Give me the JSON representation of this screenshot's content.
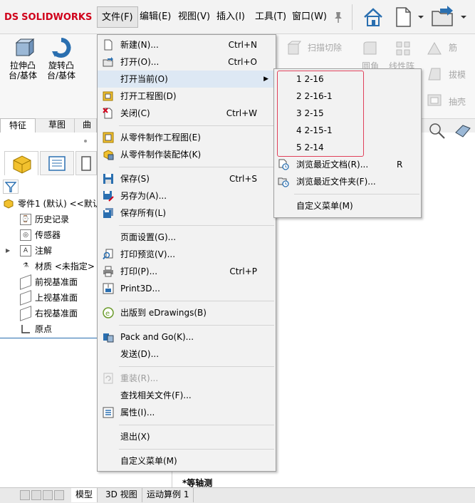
{
  "app": {
    "brand": "SOLIDWORKS",
    "brand_mark": "DS"
  },
  "menubar": [
    "文件(F)",
    "编辑(E)",
    "视图(V)",
    "插入(I)",
    "工具(T)",
    "窗口(W)"
  ],
  "commands": {
    "extrude_boss": "拉伸凸台/基体",
    "revolve_boss": "旋转凸台/基体",
    "extrude_cut": "扫描切除",
    "fillet": "圆角",
    "linear_pattern": "线性阵",
    "rib": "筋",
    "draft": "拔模",
    "shell": "抽壳"
  },
  "tabs": [
    "特征",
    "草图",
    "曲"
  ],
  "tree": {
    "root": "零件1 (默认) <<默认",
    "items": [
      "历史记录",
      "传感器",
      "注解",
      "材质 <未指定>",
      "前视基准面",
      "上视基准面",
      "右视基准面",
      "原点"
    ]
  },
  "file_menu": {
    "items": [
      {
        "label": "新建(N)...",
        "shortcut": "Ctrl+N"
      },
      {
        "label": "打开(O)...",
        "shortcut": "Ctrl+O"
      },
      {
        "label": "打开当前(O)",
        "shortcut": ""
      },
      {
        "label": "打开工程图(D)",
        "shortcut": ""
      },
      {
        "label": "关闭(C)",
        "shortcut": "Ctrl+W"
      },
      {
        "label": "从零件制作工程图(E)",
        "shortcut": ""
      },
      {
        "label": "从零件制作装配体(K)",
        "shortcut": ""
      },
      {
        "label": "保存(S)",
        "shortcut": "Ctrl+S"
      },
      {
        "label": "另存为(A)...",
        "shortcut": ""
      },
      {
        "label": "保存所有(L)",
        "shortcut": ""
      },
      {
        "label": "页面设置(G)...",
        "shortcut": ""
      },
      {
        "label": "打印预览(V)...",
        "shortcut": ""
      },
      {
        "label": "打印(P)...",
        "shortcut": "Ctrl+P"
      },
      {
        "label": "Print3D...",
        "shortcut": ""
      },
      {
        "label": "出版到 eDrawings(B)",
        "shortcut": ""
      },
      {
        "label": "Pack and Go(K)...",
        "shortcut": ""
      },
      {
        "label": "发送(D)...",
        "shortcut": ""
      },
      {
        "label": "重装(R)...",
        "shortcut": ""
      },
      {
        "label": "查找相关文件(F)...",
        "shortcut": ""
      },
      {
        "label": "属性(I)...",
        "shortcut": ""
      },
      {
        "label": "退出(X)",
        "shortcut": ""
      },
      {
        "label": "自定义菜单(M)",
        "shortcut": ""
      }
    ]
  },
  "recent_menu": {
    "recent_files": [
      "1 2-16",
      "2 2-16-1",
      "3 2-15",
      "4 2-15-1",
      "5 2-14"
    ],
    "browse_recent_docs": "浏览最近文档(R)...",
    "browse_recent_docs_shortcut": "R",
    "browse_recent_folders": "浏览最近文件夹(F)...",
    "customize": "自定义菜单(M)"
  },
  "viewport": {
    "view_label": "*等轴测"
  },
  "bottom_tabs": [
    "模型",
    "3D 视图",
    "运动算例 1"
  ],
  "colors": {
    "brand_red": "#d0021b",
    "highlight_box": "#e0405a"
  }
}
